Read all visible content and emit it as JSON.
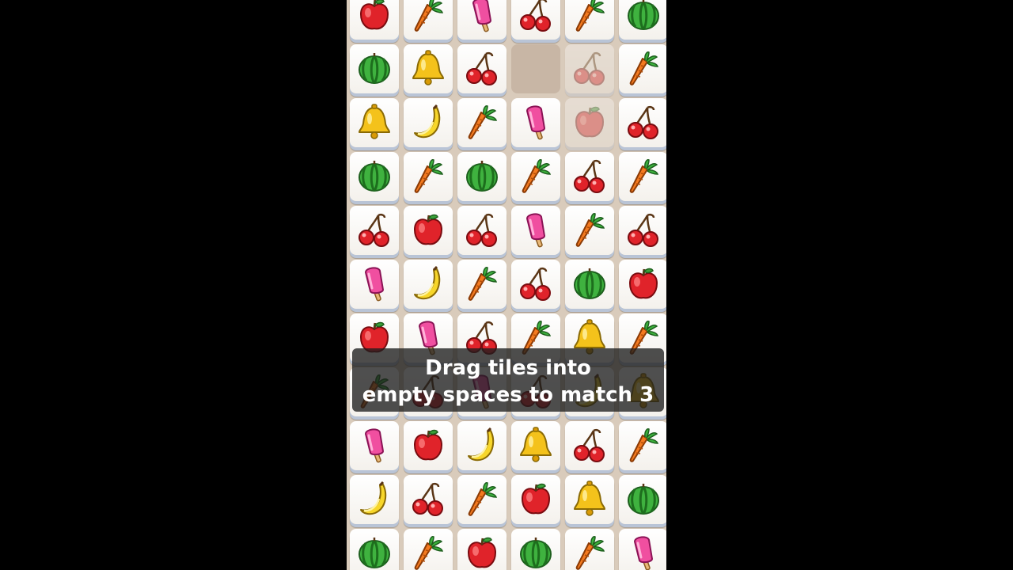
{
  "caption": {
    "line1": "Drag tiles into",
    "line2": "empty spaces to match 3"
  },
  "board": {
    "rows": [
      [
        "apple",
        "carrot",
        "popsicle",
        "cherry",
        "carrot",
        "watermelon"
      ],
      [
        "watermelon",
        "bell",
        "cherry",
        "empty",
        "cherry-ghost",
        "carrot"
      ],
      [
        "bell",
        "banana",
        "carrot",
        "popsicle",
        "apple-ghost",
        "cherry"
      ],
      [
        "watermelon",
        "carrot",
        "watermelon",
        "carrot",
        "cherry",
        "carrot"
      ],
      [
        "cherry",
        "apple",
        "cherry",
        "popsicle",
        "carrot",
        "cherry"
      ],
      [
        "popsicle",
        "banana",
        "carrot",
        "cherry",
        "watermelon",
        "apple"
      ],
      [
        "apple",
        "popsicle",
        "cherry",
        "carrot",
        "bell",
        "carrot"
      ],
      [
        "carrot",
        "cherry",
        "popsicle",
        "cherry",
        "banana",
        "bell"
      ],
      [
        "popsicle",
        "apple",
        "banana",
        "bell",
        "cherry",
        "carrot"
      ],
      [
        "banana",
        "cherry",
        "carrot",
        "apple",
        "bell",
        "watermelon"
      ],
      [
        "watermelon",
        "carrot",
        "apple",
        "watermelon",
        "carrot",
        "popsicle"
      ]
    ]
  },
  "icons": {
    "apple": "apple-icon",
    "carrot": "carrot-icon",
    "popsicle": "popsicle-icon",
    "cherry": "cherry-icon",
    "watermelon": "watermelon-icon",
    "bell": "bell-icon",
    "banana": "banana-icon"
  },
  "colors": {
    "background": "#000000",
    "board": "#d9cbbb",
    "tile_face": "#ffffff",
    "tile_edge": "#b9c4d6"
  }
}
